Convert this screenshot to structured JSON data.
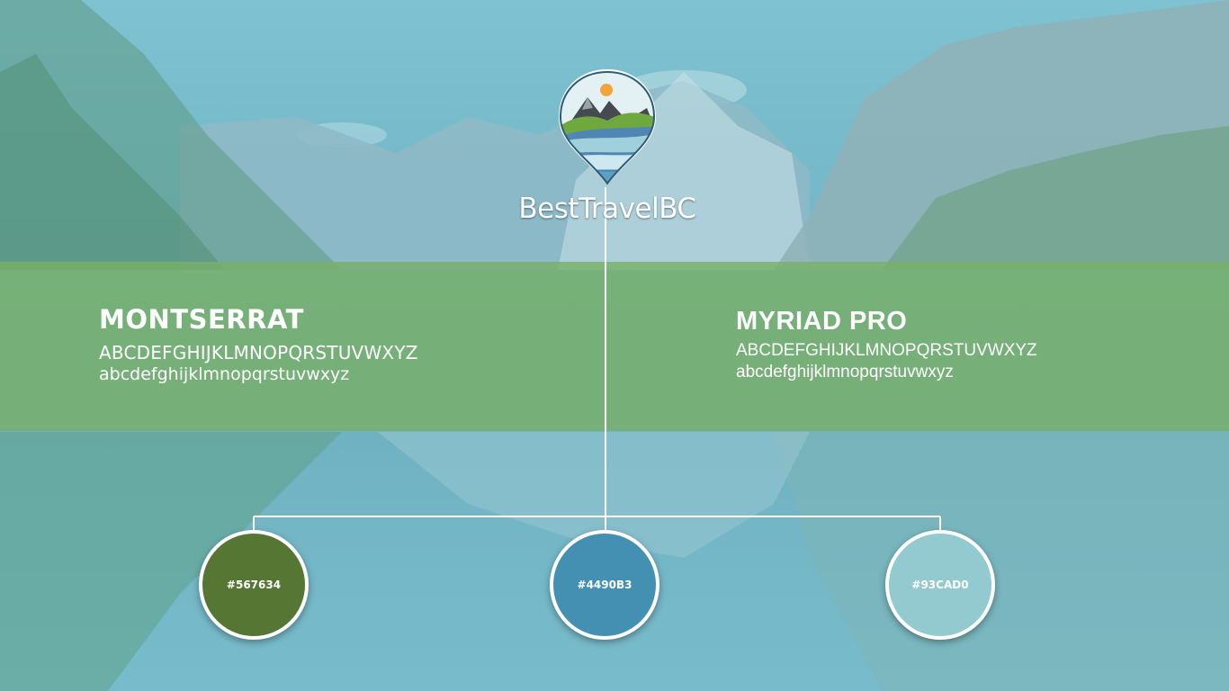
{
  "brand": {
    "name": "BestTravelBC"
  },
  "fonts": [
    {
      "name": "MONTSERRAT",
      "uppercase": "ABCDEFGHIJKLMNOPQRSTUVWXYZ",
      "lowercase": "abcdefghijklmnopqrstuvwxyz"
    },
    {
      "name": "MYRIAD PRO",
      "uppercase": "ABCDEFGHIJKLMNOPQRSTUVWXYZ",
      "lowercase": "abcdefghijklmnopqrstuvwxyz"
    }
  ],
  "palette": [
    {
      "label": "#567634",
      "color": "#567634"
    },
    {
      "label": "#4490B3",
      "color": "#4490B3"
    },
    {
      "label": "#93CAD0",
      "color": "#93CAD0"
    }
  ],
  "icons": {
    "logo": "map-pin-mountain-logo-icon"
  },
  "colors": {
    "band": "#78b068",
    "line": "#ffffff"
  }
}
